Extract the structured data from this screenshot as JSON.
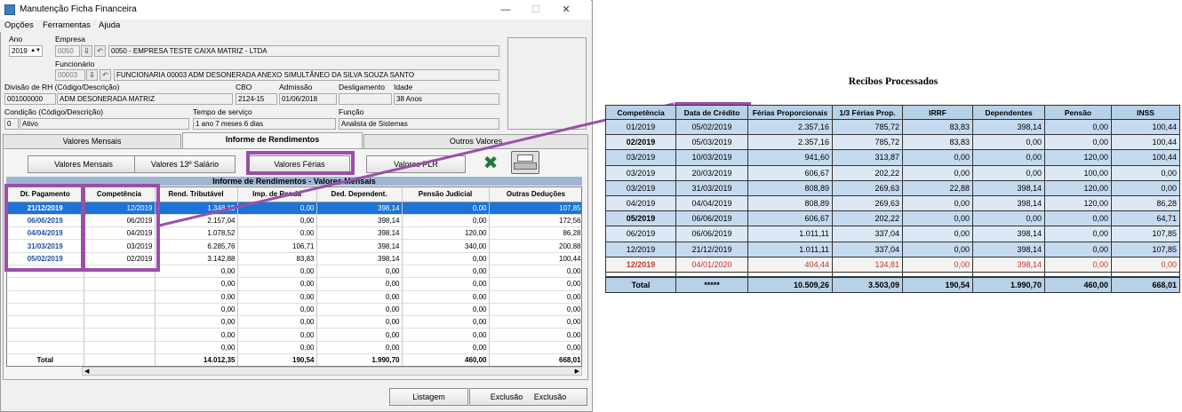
{
  "window": {
    "title": "Manutenção Ficha Financeira",
    "menu": [
      "Opções",
      "Ferramentas",
      "Ajuda"
    ]
  },
  "form": {
    "ano_label": "Ano",
    "ano_value": "2019",
    "empresa_label": "Empresa",
    "empresa_code": "0050",
    "empresa_name": "0050 - EMPRESA TESTE CAIXA MATRIZ  -  LTDA",
    "funcionario_label": "Funcionário",
    "funcionario_code": "00003",
    "funcionario_name": "FUNCIONARIA 00003 ADM DESONERADA ANEXO SIMULTÂNEO DA SILVA SOUZA SANTO",
    "divisao_label": "Divisão de RH (Código/Descrição)",
    "divisao_code": "001000000",
    "divisao_desc": "ADM DESONERADA MATRIZ",
    "cbo_label": "CBO",
    "cbo_value": "2124-15",
    "admissao_label": "Admissão",
    "admissao_value": "01/06/2018",
    "desligamento_label": "Desligamento",
    "desligamento_value": "",
    "idade_label": "Idade",
    "idade_value": "38 Anos",
    "condicao_label": "Condição (Código/Descrição)",
    "condicao_code": "0",
    "condicao_desc": "Ativo",
    "tempo_label": "Tempo de serviço",
    "tempo_value": "1 ano 7 meses 6 dias",
    "funcao_label": "Função",
    "funcao_value": "Analista de Sistemas"
  },
  "tabs": [
    "Valores Mensais",
    "Informe de Rendimentos",
    "Outros Valores"
  ],
  "buttons": {
    "valores_mensais": "Valores Mensais",
    "valores_13": "Valores 13º Salário",
    "valores_ferias": "Valores Férias",
    "valores_plr": "Valores PLR",
    "listagem": "Listagem",
    "exclusao": "Exclusão",
    "exclusao2": "Exclusão"
  },
  "grid": {
    "title": "Informe de Rendimentos - Valores Mensais",
    "columns": [
      "Dt. Pagamento",
      "Competência",
      "Rend. Tributável",
      "Imp. de Renda",
      "Ded. Dependent.",
      "Pensão Judicial",
      "Outras Deduções"
    ],
    "rows": [
      [
        "21/12/2019",
        "12/2019",
        "1.348,15",
        "0,00",
        "398,14",
        "0,00",
        "107,85"
      ],
      [
        "06/06/2019",
        "06/2019",
        "2.157,04",
        "0,00",
        "398,14",
        "0,00",
        "172,56"
      ],
      [
        "04/04/2019",
        "04/2019",
        "1.078,52",
        "0,00",
        "398,14",
        "120,00",
        "86,28"
      ],
      [
        "31/03/2019",
        "03/2019",
        "6.285,76",
        "106,71",
        "398,14",
        "340,00",
        "200,88"
      ],
      [
        "05/02/2019",
        "02/2019",
        "3.142,88",
        "83,83",
        "398,14",
        "0,00",
        "100,44"
      ],
      [
        "",
        "",
        "0,00",
        "0,00",
        "0,00",
        "0,00",
        "0,00"
      ],
      [
        "",
        "",
        "0,00",
        "0,00",
        "0,00",
        "0,00",
        "0,00"
      ],
      [
        "",
        "",
        "0,00",
        "0,00",
        "0,00",
        "0,00",
        "0,00"
      ],
      [
        "",
        "",
        "0,00",
        "0,00",
        "0,00",
        "0,00",
        "0,00"
      ],
      [
        "",
        "",
        "0,00",
        "0,00",
        "0,00",
        "0,00",
        "0,00"
      ],
      [
        "",
        "",
        "0,00",
        "0,00",
        "0,00",
        "0,00",
        "0,00"
      ],
      [
        "",
        "",
        "0,00",
        "0,00",
        "0,00",
        "0,00",
        "0,00"
      ]
    ],
    "total": [
      "Total",
      "",
      "14.012,35",
      "190,54",
      "1.990,70",
      "460,00",
      "668,01"
    ]
  },
  "recibos": {
    "title": "Recibos Processados",
    "columns": [
      "Competência",
      "Data de Crédito",
      "Férias Proporcionais",
      "1/3 Férias Prop.",
      "IRRF",
      "Dependentes",
      "Pensão",
      "INSS"
    ],
    "rows": [
      [
        "01/2019",
        "05/02/2019",
        "2.357,16",
        "785,72",
        "83,83",
        "398,14",
        "0,00",
        "100,44"
      ],
      [
        "02/2019",
        "05/03/2019",
        "2.357,16",
        "785,72",
        "83,83",
        "0,00",
        "0,00",
        "100,44"
      ],
      [
        "03/2019",
        "10/03/2019",
        "941,60",
        "313,87",
        "0,00",
        "0,00",
        "120,00",
        "100,44"
      ],
      [
        "03/2019",
        "20/03/2019",
        "606,67",
        "202,22",
        "0,00",
        "0,00",
        "100,00",
        "0,00"
      ],
      [
        "03/2019",
        "31/03/2019",
        "808,89",
        "269,63",
        "22,88",
        "398,14",
        "120,00",
        "0,00"
      ],
      [
        "04/2019",
        "04/04/2019",
        "808,89",
        "269,63",
        "0,00",
        "398,14",
        "120,00",
        "86,28"
      ],
      [
        "05/2019",
        "06/06/2019",
        "606,67",
        "202,22",
        "0,00",
        "0,00",
        "0,00",
        "64,71"
      ],
      [
        "06/2019",
        "06/06/2019",
        "1.011,11",
        "337,04",
        "0,00",
        "398,14",
        "0,00",
        "107,85"
      ],
      [
        "12/2019",
        "21/12/2019",
        "1.011,11",
        "337,04",
        "0,00",
        "398,14",
        "0,00",
        "107,85"
      ],
      [
        "12/2019",
        "04/01/2020",
        "404,44",
        "134,81",
        "0,00",
        "398,14",
        "0,00",
        "0,00"
      ]
    ],
    "bold_comp_rows": [
      1,
      6,
      9
    ],
    "red_row": 9,
    "total": [
      "Total",
      "*****",
      "10.509,26",
      "3.503,09",
      "190,54",
      "1.990,70",
      "460,00",
      "668,01"
    ]
  },
  "colors": {
    "highlight": "#9b4fa8",
    "selection": "#1c73d8",
    "header_blue": "#b7d1e8",
    "red_text": "#c0392b"
  }
}
